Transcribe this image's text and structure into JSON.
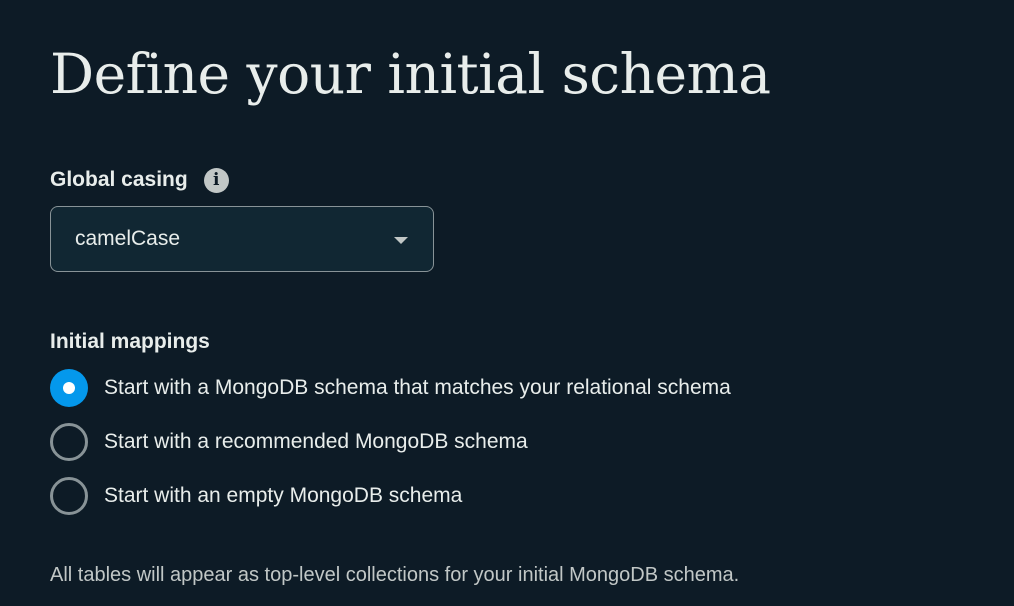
{
  "title": "Define your initial schema",
  "global_casing": {
    "label": "Global casing",
    "info_icon": "info-icon",
    "selected_value": "camelCase"
  },
  "initial_mappings": {
    "label": "Initial mappings",
    "options": [
      {
        "label": "Start with a MongoDB schema that matches your relational schema",
        "selected": true
      },
      {
        "label": "Start with a recommended MongoDB schema",
        "selected": false
      },
      {
        "label": "Start with an empty MongoDB schema",
        "selected": false
      }
    ]
  },
  "helper_text": "All tables will appear as top-level collections for your initial MongoDB schema.",
  "colors": {
    "background": "#0d1b26",
    "text": "#e8edeb",
    "muted_text": "#c1c7c6",
    "border": "#889397",
    "accent": "#0498ec"
  }
}
